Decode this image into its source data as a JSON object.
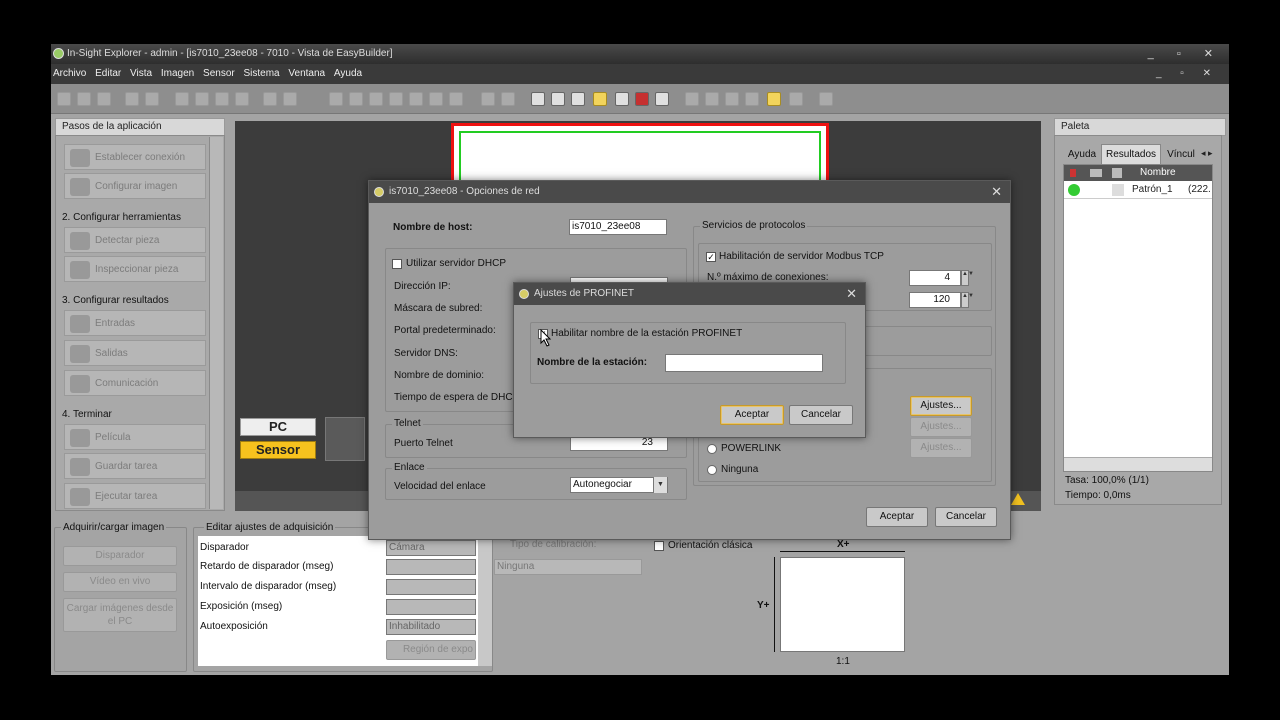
{
  "window": {
    "title": "In-Sight Explorer - admin - [is7010_23ee08 - 7010 - Vista de EasyBuilder]",
    "controls": "_ ▫ ✕",
    "mdi_controls": "_ ▫ ✕"
  },
  "menu": [
    "Archivo",
    "Editar",
    "Vista",
    "Imagen",
    "Sensor",
    "Sistema",
    "Ventana",
    "Ayuda"
  ],
  "left_panel": {
    "title": "Pasos de la aplicación",
    "steps": [
      "Establecer conexión",
      "Configurar imagen"
    ],
    "section2": "2. Configurar herramientas",
    "steps2": [
      "Detectar pieza",
      "Inspeccionar pieza"
    ],
    "section3": "3. Configurar resultados",
    "steps3": [
      "Entradas",
      "Salidas",
      "Comunicación"
    ],
    "section4": "4. Terminar",
    "steps4": [
      "Película",
      "Guardar tarea",
      "Ejecutar tarea"
    ]
  },
  "image_area": {
    "pc_label": "PC",
    "sensor_label": "Sensor"
  },
  "palette": {
    "title": "Paleta",
    "tabs": [
      "Ayuda",
      "Resultados",
      "Víncul"
    ],
    "col_name": "Nombre",
    "row": {
      "name": "Patrón_1",
      "value": "(222."
    },
    "rate": "Tasa: 100,0% (1/1)",
    "time": "Tiempo: 0,0ms"
  },
  "acquire": {
    "title": "Adquirir/cargar imagen",
    "trigger_btn": "Disparador",
    "live_btn": "Vídeo en vivo",
    "load_btn_1": "Cargar imágenes desde",
    "load_btn_2": "el PC"
  },
  "acq_settings": {
    "title": "Editar ajustes de adquisición",
    "rows": [
      {
        "label": "Disparador",
        "value": "Cámara"
      },
      {
        "label": "Retardo de disparador (mseg)",
        "value": ""
      },
      {
        "label": "Intervalo de disparador (mseg)",
        "value": ""
      },
      {
        "label": "Exposición (mseg)",
        "value": ""
      },
      {
        "label": "Autoexposición",
        "value": "Inhabilitado"
      }
    ],
    "region_btn": "Región de expo"
  },
  "calibration": {
    "type_label": "Tipo de calibración:",
    "type_value": "Ninguna",
    "classic_label": "Orientación clásica",
    "x_axis": "X+",
    "y_axis": "Y+",
    "ratio": "1:1"
  },
  "network_dialog": {
    "title": "is7010_23ee08 - Opciones de red",
    "hostname_label": "Nombre de host:",
    "hostname_value": "is7010_23ee08",
    "dhcp_label": "Utilizar servidor DHCP",
    "ip_label": "Dirección IP:",
    "mask_label": "Máscara de subred:",
    "gateway_label": "Portal predeterminado:",
    "dns_label": "Servidor DNS:",
    "domain_label": "Nombre de dominio:",
    "dhcp_timeout_label": "Tiempo de espera de DHCP:",
    "telnet_group": "Telnet",
    "telnet_port_label": "Puerto Telnet",
    "telnet_port_value": "23",
    "link_group": "Enlace",
    "link_speed_label": "Velocidad del enlace",
    "link_speed_value": "Autonegociar",
    "protocols_group": "Servicios de protocolos",
    "modbus_label": "Habilitación de servidor Modbus TCP",
    "max_conn_label": "N.º máximo de conexiones:",
    "max_conn_value": "4",
    "timeout_value": "120",
    "powerlink_label": "POWERLINK",
    "none_label": "Ninguna",
    "settings_btn": "Ajustes...",
    "ok_btn": "Aceptar",
    "cancel_btn": "Cancelar"
  },
  "profinet_dialog": {
    "title": "Ajustes de PROFINET",
    "enable_label": "Habilitar nombre de la estación PROFINET",
    "station_label": "Nombre de la estación:",
    "station_value": "",
    "ok_btn": "Aceptar",
    "cancel_btn": "Cancelar"
  }
}
